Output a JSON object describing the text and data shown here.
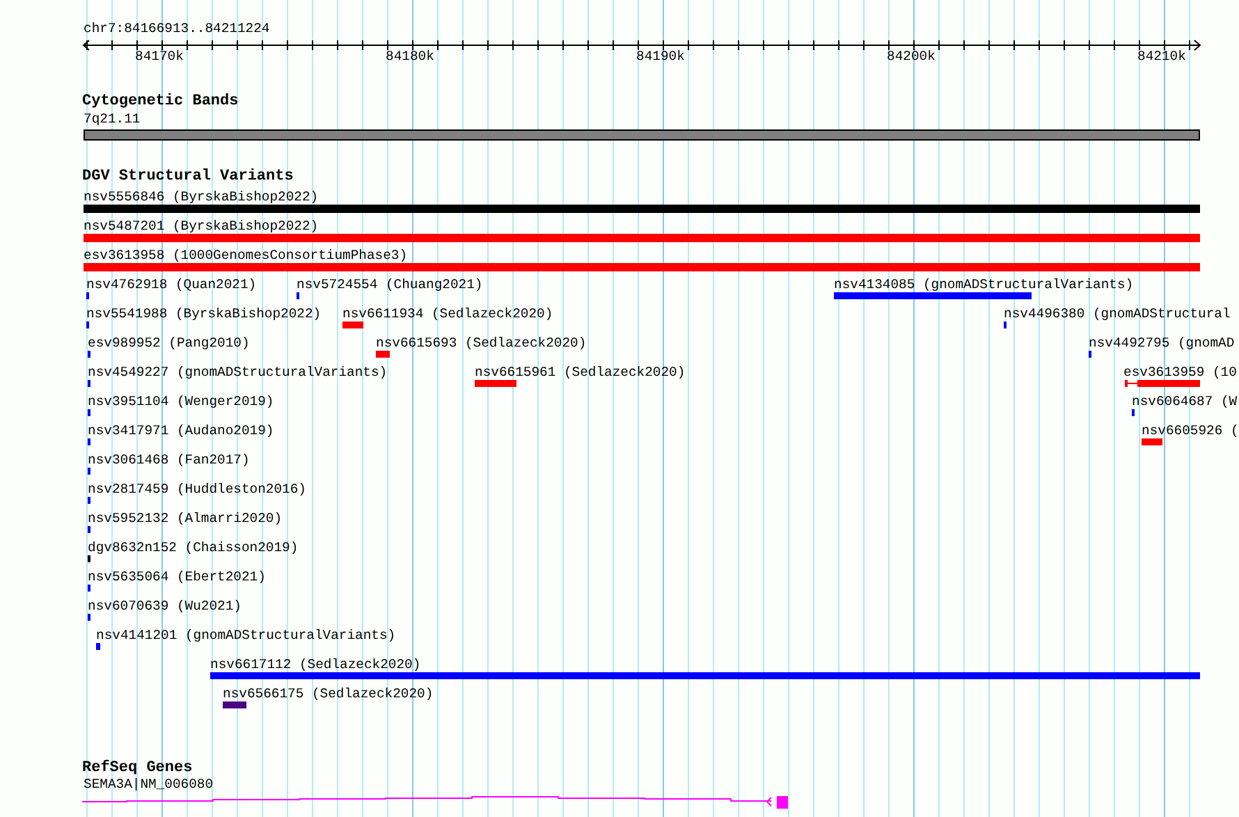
{
  "ruler": {
    "range": "chr7:84166913..84211224",
    "ticks": [
      "84170k",
      "84180k",
      "84190k",
      "84200k",
      "84210k"
    ]
  },
  "bands": {
    "title": "Cytogenetic Bands",
    "label": "7q21.11"
  },
  "variants": {
    "title": "DGV Structural Variants",
    "rows": [
      {
        "features": [
          {
            "label": "nsv5556846 (ByrskaBishop2022)",
            "color": "#000000"
          }
        ]
      },
      {
        "features": [
          {
            "label": "nsv5487201 (ByrskaBishop2022)",
            "color": "#ff0000"
          }
        ]
      },
      {
        "features": [
          {
            "label": "esv3613958 (1000GenomesConsortiumPhase3)",
            "color": "#ff0000"
          }
        ]
      },
      {
        "features": [
          {
            "label": "nsv4762918 (Quan2021)",
            "color": "#0000ff"
          },
          {
            "label": "nsv5724554 (Chuang2021)",
            "color": "#0000ff"
          },
          {
            "label": "nsv4134085 (gnomADStructuralVariants)",
            "color": "#0000ff"
          }
        ]
      },
      {
        "features": [
          {
            "label": "nsv5541988 (ByrskaBishop2022)",
            "color": "#0000ff"
          },
          {
            "label": "nsv6611934 (Sedlazeck2020)",
            "color": "#ff0000"
          },
          {
            "label": "nsv4496380 (gnomADStructural",
            "color": "#0000ff"
          }
        ]
      },
      {
        "features": [
          {
            "label": "esv989952 (Pang2010)",
            "color": "#0000ff"
          },
          {
            "label": "nsv6615693 (Sedlazeck2020)",
            "color": "#ff0000"
          },
          {
            "label": "nsv4492795 (gnomAD",
            "color": "#0000ff"
          }
        ]
      },
      {
        "features": [
          {
            "label": "nsv4549227 (gnomADStructuralVariants)",
            "color": "#0000ff"
          },
          {
            "label": "nsv6615961 (Sedlazeck2020)",
            "color": "#ff0000"
          },
          {
            "label": "esv3613959 (10",
            "color": "#ff0000"
          }
        ]
      },
      {
        "features": [
          {
            "label": "nsv3951104 (Wenger2019)",
            "color": "#0000ff"
          },
          {
            "label": "nsv6064687 (W",
            "color": "#0000ff"
          }
        ]
      },
      {
        "features": [
          {
            "label": "nsv3417971 (Audano2019)",
            "color": "#0000ff"
          },
          {
            "label": "nsv6605926 (",
            "color": "#ff0000"
          }
        ]
      },
      {
        "features": [
          {
            "label": "nsv3061468 (Fan2017)",
            "color": "#0000ff"
          }
        ]
      },
      {
        "features": [
          {
            "label": "nsv2817459 (Huddleston2016)",
            "color": "#0000ff"
          }
        ]
      },
      {
        "features": [
          {
            "label": "nsv5952132 (Almarri2020)",
            "color": "#0000ff"
          }
        ]
      },
      {
        "features": [
          {
            "label": "dgv8632n152 (Chaisson2019)",
            "color": "#000000"
          }
        ]
      },
      {
        "features": [
          {
            "label": "nsv5635064 (Ebert2021)",
            "color": "#0000ff"
          }
        ]
      },
      {
        "features": [
          {
            "label": "nsv6070639 (Wu2021)",
            "color": "#0000ff"
          }
        ]
      },
      {
        "features": [
          {
            "label": "nsv4141201 (gnomADStructuralVariants)",
            "color": "#0000ff"
          }
        ]
      },
      {
        "features": [
          {
            "label": "nsv6617112 (Sedlazeck2020)",
            "color": "#0000ff"
          }
        ]
      },
      {
        "features": [
          {
            "label": "nsv6566175 (Sedlazeck2020)",
            "color": "#4b0082"
          }
        ]
      }
    ]
  },
  "genes": {
    "title": "RefSeq Genes",
    "label": "SEMA3A|NM_006080"
  }
}
